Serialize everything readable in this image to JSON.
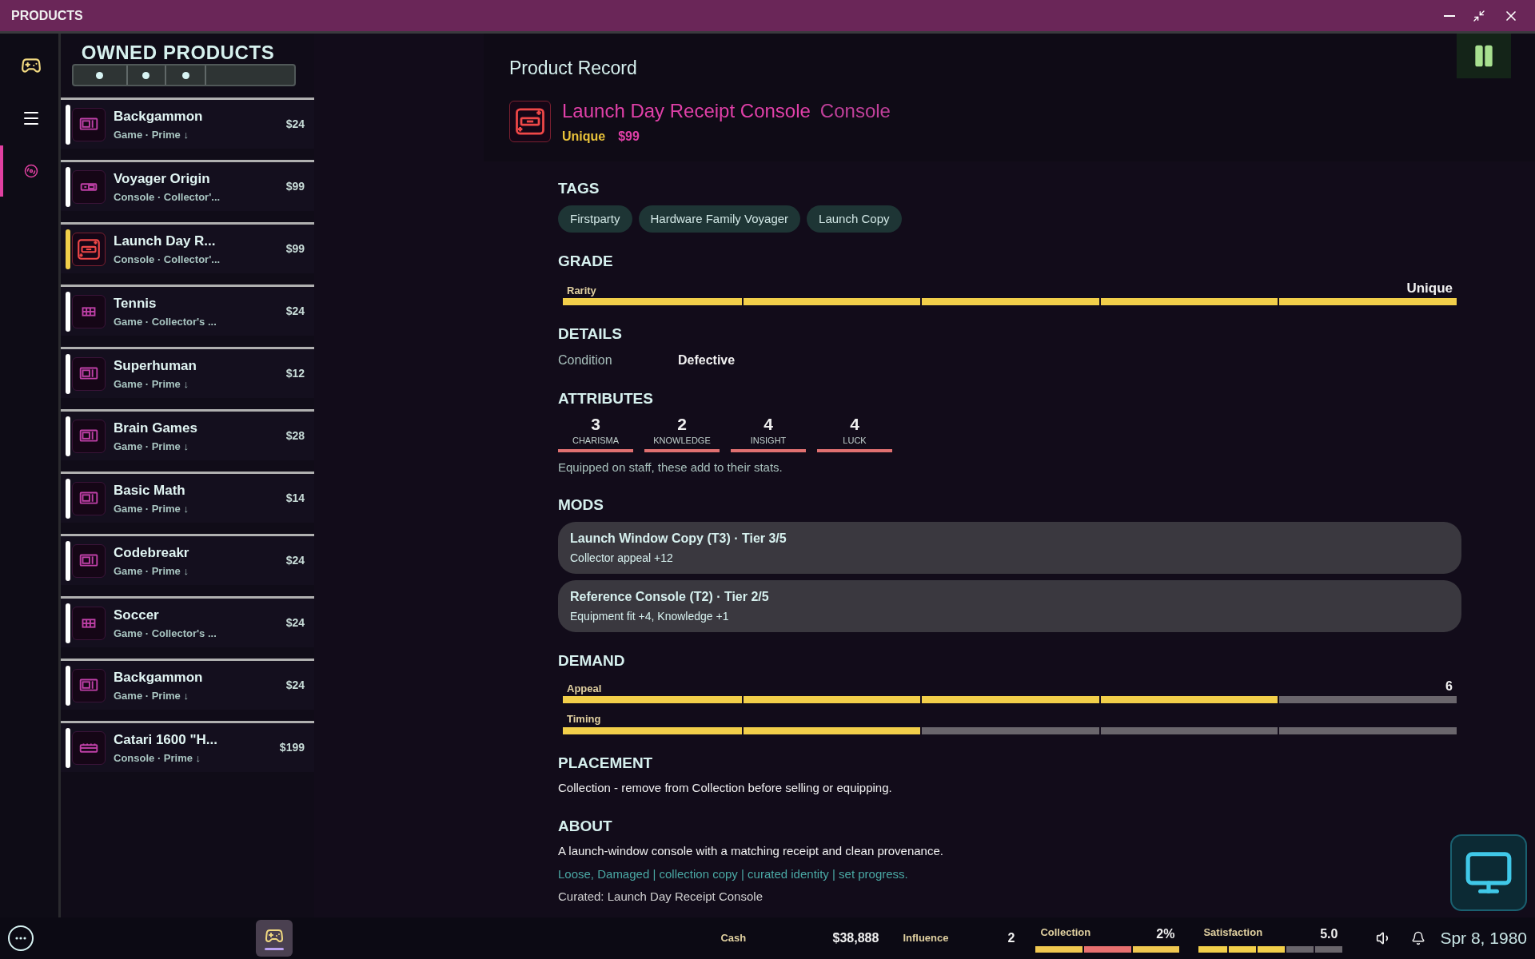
{
  "window": {
    "title": "PRODUCTS"
  },
  "rail": [
    {
      "kind": "controller",
      "selected": false
    },
    {
      "kind": "menu",
      "selected": false
    },
    {
      "kind": "disc",
      "selected": true
    }
  ],
  "list": {
    "title": "OWNED PRODUCTS",
    "tab_dots": [
      {
        "selected": false
      },
      {
        "selected": false
      },
      {
        "selected": false
      }
    ],
    "items": [
      {
        "name": "Backgammon",
        "sub": "Game · Prime ↓",
        "price": "$24",
        "kind": "cartridge",
        "selected": false
      },
      {
        "name": "Voyager Origin",
        "sub": "Console · Collector'...",
        "price": "$99",
        "kind": "console",
        "selected": false
      },
      {
        "name": "Launch Day R...",
        "sub": "Console · Collector'...",
        "price": "$99",
        "kind": "console",
        "selected": true
      },
      {
        "name": "Tennis",
        "sub": "Game · Collector's ...",
        "price": "$24",
        "kind": "grid",
        "selected": false
      },
      {
        "name": "Superhuman",
        "sub": "Game · Prime ↓",
        "price": "$12",
        "kind": "cartridge",
        "selected": false
      },
      {
        "name": "Brain Games",
        "sub": "Game · Prime ↓",
        "price": "$28",
        "kind": "cartridge",
        "selected": false
      },
      {
        "name": "Basic Math",
        "sub": "Game · Prime ↓",
        "price": "$14",
        "kind": "cartridge",
        "selected": false
      },
      {
        "name": "Codebreakr",
        "sub": "Game · Prime ↓",
        "price": "$24",
        "kind": "cartridge",
        "selected": false
      },
      {
        "name": "Soccer",
        "sub": "Game · Collector's ...",
        "price": "$24",
        "kind": "grid",
        "selected": false
      },
      {
        "name": "Backgammon",
        "sub": "Game · Prime ↓",
        "price": "$24",
        "kind": "cartridge",
        "selected": false
      },
      {
        "name": "Catari 1600 \"H...",
        "sub": "Console · Prime ↓",
        "price": "$199",
        "kind": "keyboard",
        "selected": false
      }
    ]
  },
  "record": {
    "heading": "Product Record",
    "name": "Launch Day Receipt Console",
    "type": "Console",
    "rarity": "Unique",
    "price": "$99",
    "tags_title": "TAGS",
    "tags": [
      "Firstparty",
      "Hardware Family Voyager",
      "Launch Copy"
    ],
    "grade_title": "GRADE",
    "grade": [
      {
        "label": "Rarity",
        "value": "Unique",
        "level": 1.0
      }
    ],
    "details_title": "DETAILS",
    "details": [
      {
        "label": "Condition",
        "value": "Defective"
      }
    ],
    "attributes_title": "ATTRIBUTES",
    "attributes": [
      {
        "value": "3",
        "label": "CHARISMA"
      },
      {
        "value": "2",
        "label": "KNOWLEDGE"
      },
      {
        "value": "4",
        "label": "INSIGHT"
      },
      {
        "value": "4",
        "label": "LUCK"
      }
    ],
    "attributes_note": "Equipped on staff, these add to their stats.",
    "mods_title": "MODS",
    "mods": [
      {
        "title": "Launch Window Copy (T3) · Tier 3/5",
        "desc": "Collector appeal +12"
      },
      {
        "title": "Reference Console (T2) · Tier 2/5",
        "desc": "Equipment fit +4, Knowledge +1"
      }
    ],
    "demand_title": "DEMAND",
    "demand": [
      {
        "label": "Appeal",
        "value": "6",
        "level": 0.8
      },
      {
        "label": "Timing",
        "level": 0.4
      }
    ],
    "placement_title": "PLACEMENT",
    "placement": "Collection - remove from Collection before selling or equipping.",
    "about_title": "ABOUT",
    "about": [
      "A launch-window console with a matching receipt and clean provenance.",
      "Loose, Damaged | collection copy | curated identity | set progress.",
      "Curated: Launch Day Receipt Console"
    ]
  },
  "taskbar": {
    "apps": [
      {
        "kind": "controller",
        "selected": true
      }
    ],
    "cash": {
      "label": "Cash",
      "value": "$38,888"
    },
    "influence": {
      "label": "Influence",
      "value": "2"
    },
    "collection": {
      "label": "Collection",
      "value": "2%",
      "segments": [
        {
          "color": "#f0c850"
        },
        {
          "color": "#e87070"
        },
        {
          "color": "#f0c850"
        }
      ]
    },
    "satisfaction": {
      "label": "Satisfaction",
      "value": "5.0",
      "level": 0.6
    },
    "date": "Spr 8, 1980"
  }
}
